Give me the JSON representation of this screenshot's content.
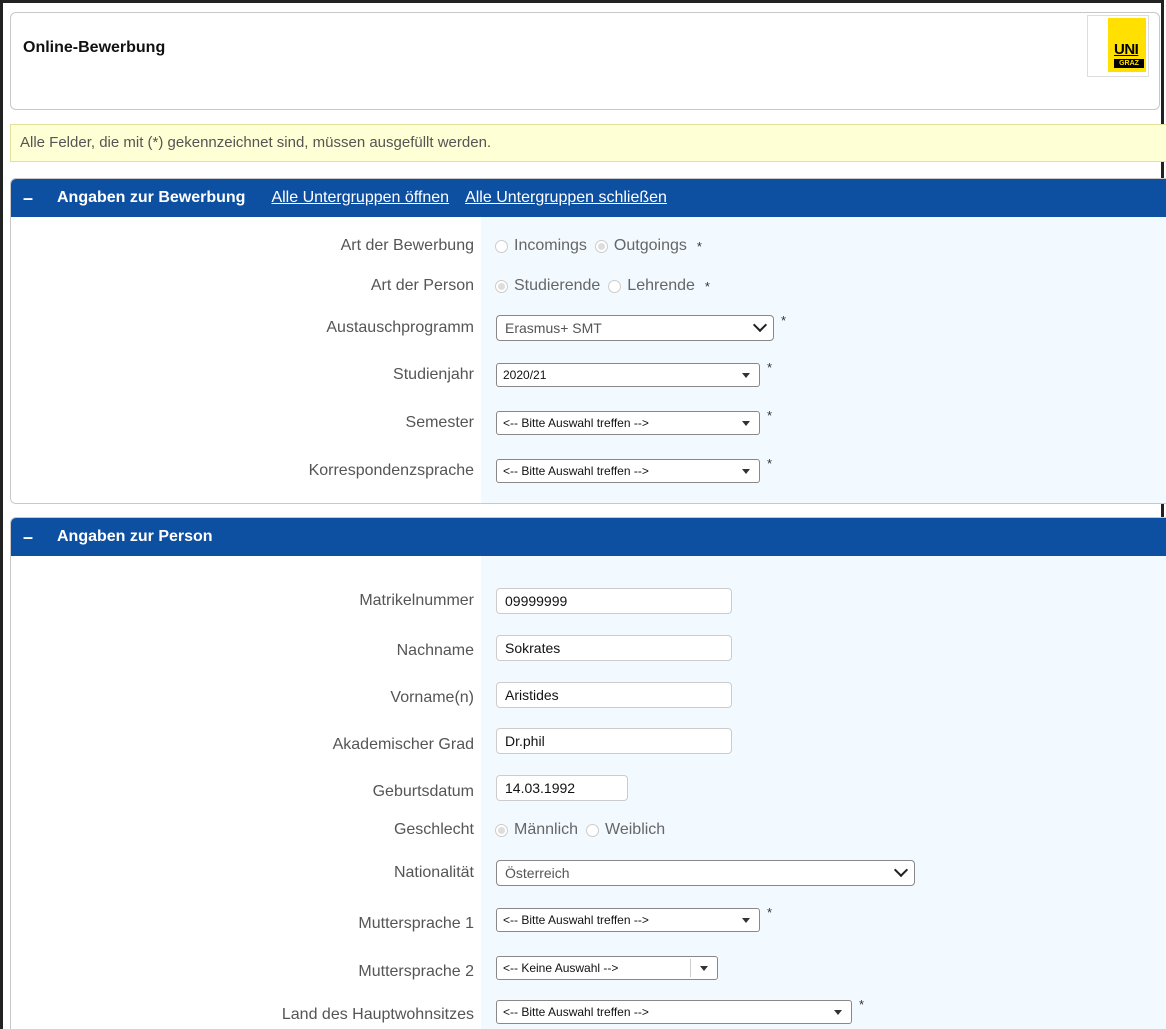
{
  "app": {
    "title": "Online-Bewerbung",
    "logo_text": "UNI",
    "logo_subtext": "GRAZ"
  },
  "notice": "Alle Felder, die mit (*) gekennzeichnet sind, müssen ausgefüllt werden.",
  "required_mark": "*",
  "section1": {
    "collapse_symbol": "–",
    "title": "Angaben zur Bewerbung",
    "open_all": "Alle Untergruppen öffnen",
    "close_all": "Alle Untergruppen schließen",
    "art_bewerbung": {
      "label": "Art der Bewerbung",
      "options": [
        "Incomings",
        "Outgoings"
      ],
      "selected": "Outgoings"
    },
    "art_person": {
      "label": "Art der Person",
      "options": [
        "Studierende",
        "Lehrende"
      ],
      "selected": "Studierende"
    },
    "austauschprogramm": {
      "label": "Austauschprogramm",
      "value": "Erasmus+ SMT"
    },
    "studienjahr": {
      "label": "Studienjahr",
      "value": "2020/21"
    },
    "semester": {
      "label": "Semester",
      "value": "<-- Bitte Auswahl treffen -->"
    },
    "korrespondenzsprache": {
      "label": "Korrespondenzsprache",
      "value": "<-- Bitte Auswahl treffen -->"
    }
  },
  "section2": {
    "collapse_symbol": "–",
    "title": "Angaben zur Person",
    "matrikelnummer": {
      "label": "Matrikelnummer",
      "value": "09999999"
    },
    "nachname": {
      "label": "Nachname",
      "value": "Sokrates"
    },
    "vorname": {
      "label": "Vorname(n)",
      "value": "Aristides"
    },
    "grad": {
      "label": "Akademischer Grad",
      "value": "Dr.phil"
    },
    "geburtsdatum": {
      "label": "Geburtsdatum",
      "value": "14.03.1992"
    },
    "geschlecht": {
      "label": "Geschlecht",
      "options": [
        "Männlich",
        "Weiblich"
      ],
      "selected": "Männlich"
    },
    "nationalitaet": {
      "label": "Nationalität",
      "value": "Österreich"
    },
    "muttersprache1": {
      "label": "Muttersprache 1",
      "value": "<-- Bitte Auswahl treffen -->"
    },
    "muttersprache2": {
      "label": "Muttersprache 2",
      "value": "<-- Keine Auswahl -->"
    },
    "land": {
      "label": "Land des Hauptwohnsitzes",
      "value": "<-- Bitte Auswahl treffen -->"
    }
  }
}
